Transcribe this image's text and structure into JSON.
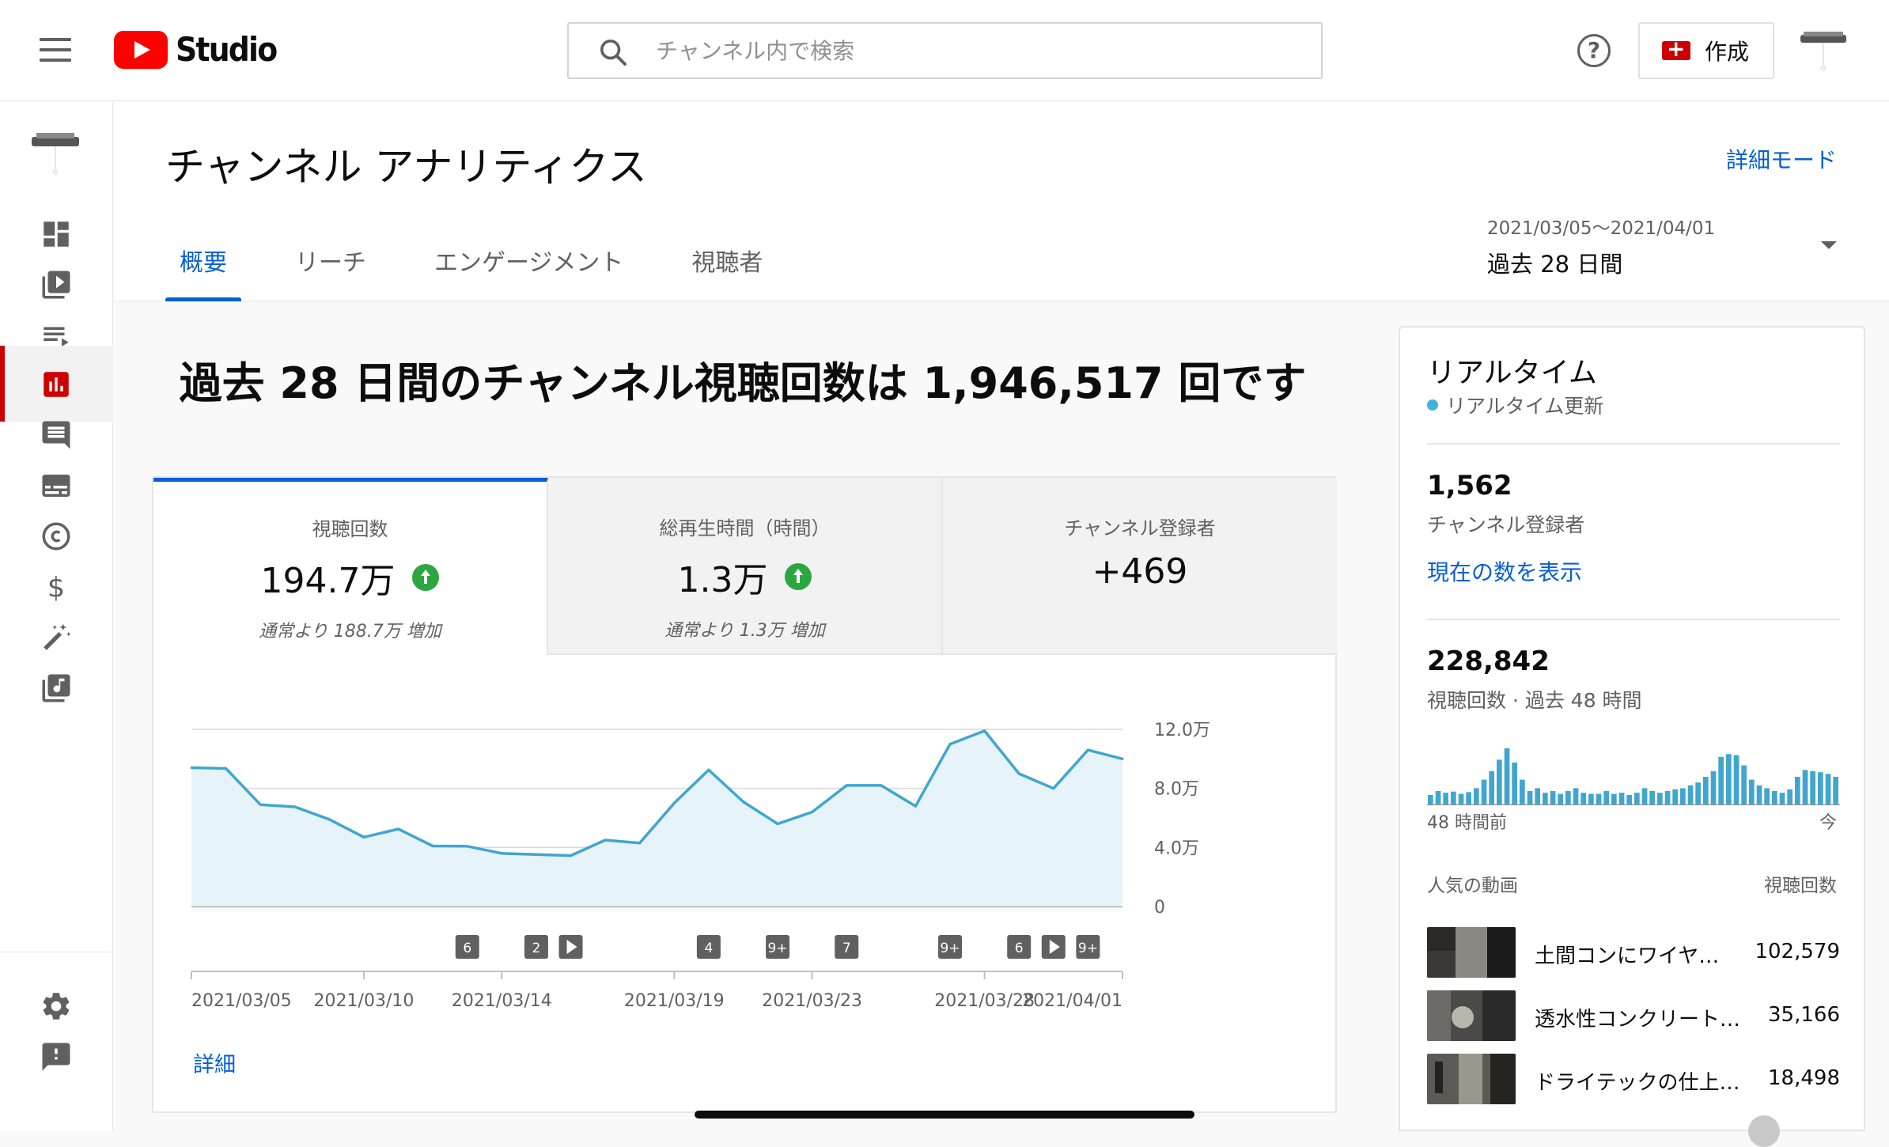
{
  "app": {
    "logo_text": "Studio"
  },
  "search": {
    "placeholder": "チャンネル内で検索"
  },
  "header": {
    "create_label": "作成",
    "help_label": "?"
  },
  "sidebar": {
    "items": [
      {
        "name": "dashboard",
        "icon": "dashboard-icon"
      },
      {
        "name": "content",
        "icon": "video-library-icon"
      },
      {
        "name": "playlists",
        "icon": "playlist-icon"
      },
      {
        "name": "analytics",
        "icon": "analytics-icon",
        "active": true
      },
      {
        "name": "comments",
        "icon": "comment-icon"
      },
      {
        "name": "subtitles",
        "icon": "subtitles-icon"
      },
      {
        "name": "copyright",
        "icon": "copyright-icon"
      },
      {
        "name": "monetization",
        "icon": "dollar-icon"
      },
      {
        "name": "customization",
        "icon": "magic-wand-icon"
      },
      {
        "name": "audio-library",
        "icon": "music-library-icon"
      },
      {
        "name": "settings",
        "icon": "gear-icon"
      },
      {
        "name": "feedback",
        "icon": "feedback-icon"
      }
    ]
  },
  "page": {
    "title": "チャンネル アナリティクス",
    "advanced_mode": "詳細モード",
    "tabs": [
      "概要",
      "リーチ",
      "エンゲージメント",
      "視聴者"
    ],
    "date_range": "2021/03/05〜2021/04/01",
    "date_label": "過去 28 日間"
  },
  "overview": {
    "headline": "過去 28 日間のチャンネル視聴回数は 1,946,517 回です",
    "metrics": [
      {
        "label": "視聴回数",
        "value": "194.7万",
        "note": "通常より 188.7万 増加",
        "trend": "up"
      },
      {
        "label": "総再生時間（時間）",
        "value": "1.3万",
        "note": "通常より 1.3万 増加",
        "trend": "up"
      },
      {
        "label": "チャンネル登録者",
        "value": "+469",
        "note": "",
        "trend": ""
      }
    ],
    "detail_link": "詳細"
  },
  "chart_data": {
    "type": "area",
    "x": [
      "2021/03/05",
      "2021/03/06",
      "2021/03/07",
      "2021/03/08",
      "2021/03/09",
      "2021/03/10",
      "2021/03/11",
      "2021/03/12",
      "2021/03/13",
      "2021/03/14",
      "2021/03/15",
      "2021/03/16",
      "2021/03/17",
      "2021/03/18",
      "2021/03/19",
      "2021/03/20",
      "2021/03/21",
      "2021/03/22",
      "2021/03/23",
      "2021/03/24",
      "2021/03/25",
      "2021/03/26",
      "2021/03/27",
      "2021/03/28",
      "2021/03/29",
      "2021/03/30",
      "2021/03/31",
      "2021/04/01"
    ],
    "values": [
      94000,
      93500,
      69000,
      67500,
      59000,
      47000,
      52500,
      41000,
      40800,
      36000,
      35200,
      34500,
      45000,
      43000,
      70000,
      92500,
      71000,
      56000,
      64000,
      82000,
      82000,
      68000,
      110000,
      119000,
      90000,
      80000,
      106000,
      100000
    ],
    "y_ticks": [
      "12.0万",
      "8.0万",
      "4.0万",
      "0"
    ],
    "ylim": [
      0,
      120000
    ],
    "x_tick_labels": [
      "2021/03/05",
      "2021/03/10",
      "2021/03/14",
      "2021/03/19",
      "2021/03/23",
      "2021/03/28",
      "2021/04/01"
    ],
    "x_tick_dates": [
      "2021/03/05",
      "2021/03/10",
      "2021/03/14",
      "2021/03/19",
      "2021/03/23",
      "2021/03/28",
      "2021/04/01"
    ],
    "upload_markers": [
      {
        "date": "2021/03/13",
        "label": "6"
      },
      {
        "date": "2021/03/15",
        "label": "2"
      },
      {
        "date": "2021/03/16",
        "label": "play"
      },
      {
        "date": "2021/03/20",
        "label": "4"
      },
      {
        "date": "2021/03/22",
        "label": "9+"
      },
      {
        "date": "2021/03/24",
        "label": "7"
      },
      {
        "date": "2021/03/27",
        "label": "9+"
      },
      {
        "date": "2021/03/29",
        "label": "6"
      },
      {
        "date": "2021/03/30",
        "label": "play"
      },
      {
        "date": "2021/03/31",
        "label": "9+"
      }
    ],
    "colors": {
      "line": "#41a6cf",
      "fill": "#e6f3f9",
      "grid": "#d9d9d9"
    }
  },
  "realtime": {
    "title": "リアルタイム",
    "subtitle": "リアルタイム更新",
    "subscribers": "1,562",
    "subscribers_caption": "チャンネル登録者",
    "show_count_link": "現在の数を表示",
    "views_48h": "228,842",
    "views_caption": "視聴回数 · 過去 48 時間",
    "bars_relative": [
      0.18,
      0.25,
      0.22,
      0.24,
      0.2,
      0.23,
      0.3,
      0.45,
      0.6,
      0.8,
      1.0,
      0.75,
      0.45,
      0.25,
      0.3,
      0.22,
      0.25,
      0.2,
      0.25,
      0.3,
      0.22,
      0.2,
      0.2,
      0.25,
      0.2,
      0.22,
      0.18,
      0.22,
      0.3,
      0.25,
      0.22,
      0.25,
      0.28,
      0.3,
      0.35,
      0.4,
      0.5,
      0.6,
      0.85,
      0.9,
      0.88,
      0.7,
      0.45,
      0.35,
      0.3,
      0.25,
      0.22,
      0.28,
      0.5,
      0.62,
      0.6,
      0.58,
      0.55,
      0.5
    ],
    "axis_left": "48 時間前",
    "axis_right": "今",
    "top_videos_label": "人気の動画",
    "views_label": "視聴回数",
    "videos": [
      {
        "title": "土間コンにワイヤ…",
        "views": "102,579"
      },
      {
        "title": "透水性コンクリート…",
        "views": "35,166"
      },
      {
        "title": "ドライテックの仕上…",
        "views": "18,498"
      }
    ]
  },
  "colors": {
    "accent": "#065fd4",
    "brand": "#ff0000",
    "active_nav": "#cc0000",
    "up": "#2ba640",
    "realtime_dot": "#41b2d9"
  }
}
